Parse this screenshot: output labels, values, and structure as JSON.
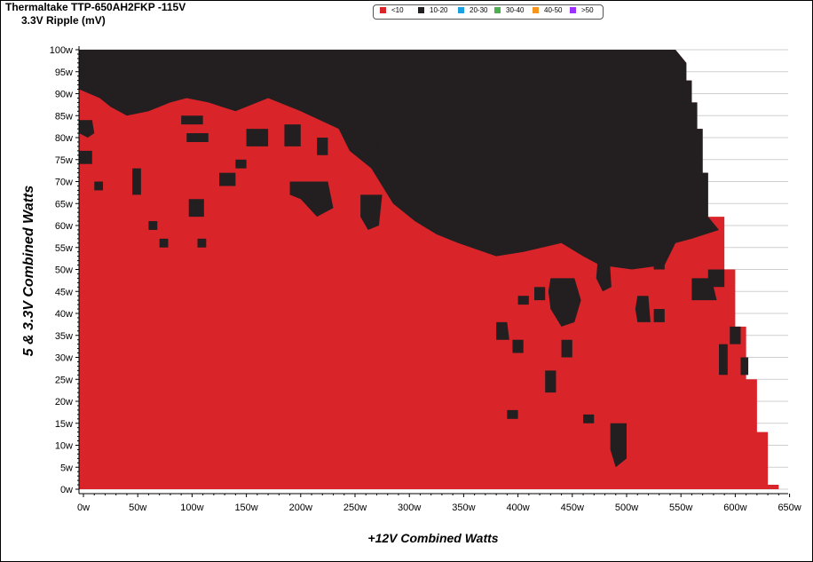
{
  "title": "Thermaltake TTP-650AH2FKP -115V",
  "subtitle": "3.3V Ripple (mV)",
  "colors": {
    "lt10": "#d9242a",
    "10-20": "#231f20",
    "20-30": "#1ba1e2",
    "30-40": "#4caf50",
    "40-50": "#f7941d",
    "gt50": "#9b30ff"
  },
  "chart_data": {
    "type": "heatmap",
    "xlabel": "+12V Combined Watts",
    "ylabel": "5 & 3.3V Combined Watts",
    "xlim": [
      0,
      650
    ],
    "ylim": [
      0,
      100
    ],
    "grid": true,
    "legend_placement": "top-center",
    "x_ticks": [
      "0w",
      "50w",
      "100w",
      "150w",
      "200w",
      "250w",
      "300w",
      "350w",
      "400w",
      "450w",
      "500w",
      "550w",
      "600w",
      "650w"
    ],
    "y_ticks": [
      "0w",
      "5w",
      "10w",
      "15w",
      "20w",
      "25w",
      "30w",
      "35w",
      "40w",
      "45w",
      "50w",
      "55w",
      "60w",
      "65w",
      "70w",
      "75w",
      "80w",
      "85w",
      "90w",
      "95w",
      "100w"
    ],
    "legend": [
      {
        "label": "<10",
        "color": "#d9242a"
      },
      {
        "label": "10-20",
        "color": "#231f20"
      },
      {
        "label": "20-30",
        "color": "#1ba1e2"
      },
      {
        "label": "30-40",
        "color": "#4caf50"
      },
      {
        "label": "40-50",
        "color": "#f7941d"
      },
      {
        "label": ">50",
        "color": "#9b30ff"
      }
    ],
    "load_limit": [
      [
        0,
        100
      ],
      [
        545,
        100
      ],
      [
        555,
        97
      ],
      [
        555,
        93
      ],
      [
        560,
        93
      ],
      [
        560,
        88
      ],
      [
        565,
        88
      ],
      [
        565,
        82
      ],
      [
        570,
        82
      ],
      [
        570,
        72
      ],
      [
        575,
        72
      ],
      [
        575,
        62
      ],
      [
        590,
        62
      ],
      [
        590,
        50
      ],
      [
        600,
        50
      ],
      [
        600,
        37
      ],
      [
        610,
        37
      ],
      [
        610,
        25
      ],
      [
        620,
        25
      ],
      [
        620,
        13
      ],
      [
        630,
        13
      ],
      [
        630,
        1
      ],
      [
        640,
        1
      ],
      [
        640,
        0
      ]
    ],
    "high_ripple_regions": [
      {
        "range": "10-20",
        "polygon": [
          [
            0,
            100
          ],
          [
            545,
            100
          ],
          [
            555,
            97
          ],
          [
            555,
            93
          ],
          [
            560,
            93
          ],
          [
            560,
            88
          ],
          [
            565,
            88
          ],
          [
            565,
            82
          ],
          [
            570,
            82
          ],
          [
            570,
            72
          ],
          [
            575,
            72
          ],
          [
            575,
            62
          ],
          [
            585,
            59
          ],
          [
            560,
            57
          ],
          [
            545,
            56
          ],
          [
            535,
            51
          ],
          [
            505,
            50
          ],
          [
            475,
            51
          ],
          [
            460,
            53
          ],
          [
            440,
            56
          ],
          [
            405,
            54
          ],
          [
            380,
            53
          ],
          [
            345,
            56
          ],
          [
            325,
            58
          ],
          [
            305,
            61
          ],
          [
            285,
            65
          ],
          [
            275,
            69
          ],
          [
            265,
            73
          ],
          [
            245,
            77
          ],
          [
            235,
            82
          ],
          [
            200,
            86
          ],
          [
            170,
            89
          ],
          [
            140,
            86
          ],
          [
            115,
            88
          ],
          [
            95,
            89
          ],
          [
            80,
            88
          ],
          [
            60,
            86
          ],
          [
            40,
            85
          ],
          [
            25,
            87
          ],
          [
            15,
            89
          ],
          [
            0,
            91
          ]
        ]
      },
      {
        "range": "10-20",
        "polygon": [
          [
            0,
            84
          ],
          [
            8,
            84
          ],
          [
            10,
            81
          ],
          [
            4,
            80
          ],
          [
            0,
            81
          ]
        ]
      },
      {
        "range": "10-20",
        "polygon": [
          [
            0,
            77
          ],
          [
            8,
            77
          ],
          [
            8,
            74
          ],
          [
            0,
            74
          ]
        ]
      },
      {
        "range": "10-20",
        "polygon": [
          [
            45,
            73
          ],
          [
            53,
            73
          ],
          [
            53,
            67
          ],
          [
            45,
            67
          ]
        ]
      },
      {
        "range": "10-20",
        "polygon": [
          [
            97,
            66
          ],
          [
            111,
            66
          ],
          [
            111,
            62
          ],
          [
            97,
            62
          ]
        ]
      },
      {
        "range": "10-20",
        "polygon": [
          [
            125,
            72
          ],
          [
            140,
            72
          ],
          [
            140,
            69
          ],
          [
            125,
            69
          ]
        ]
      },
      {
        "range": "10-20",
        "polygon": [
          [
            190,
            70
          ],
          [
            225,
            70
          ],
          [
            230,
            64
          ],
          [
            215,
            62
          ],
          [
            200,
            66
          ],
          [
            190,
            67
          ]
        ]
      },
      {
        "range": "10-20",
        "polygon": [
          [
            255,
            67
          ],
          [
            275,
            67
          ],
          [
            272,
            60
          ],
          [
            262,
            59
          ],
          [
            255,
            62
          ]
        ]
      },
      {
        "range": "10-20",
        "polygon": [
          [
            90,
            85
          ],
          [
            110,
            85
          ],
          [
            110,
            83
          ],
          [
            90,
            83
          ]
        ]
      },
      {
        "range": "10-20",
        "polygon": [
          [
            95,
            81
          ],
          [
            115,
            81
          ],
          [
            115,
            79
          ],
          [
            95,
            79
          ]
        ]
      },
      {
        "range": "10-20",
        "polygon": [
          [
            150,
            82
          ],
          [
            170,
            82
          ],
          [
            170,
            78
          ],
          [
            150,
            78
          ]
        ]
      },
      {
        "range": "10-20",
        "polygon": [
          [
            185,
            83
          ],
          [
            200,
            83
          ],
          [
            200,
            78
          ],
          [
            185,
            78
          ]
        ]
      },
      {
        "range": "10-20",
        "polygon": [
          [
            215,
            80
          ],
          [
            225,
            80
          ],
          [
            225,
            76
          ],
          [
            215,
            76
          ]
        ]
      },
      {
        "range": "10-20",
        "polygon": [
          [
            140,
            75
          ],
          [
            150,
            75
          ],
          [
            150,
            73
          ],
          [
            140,
            73
          ]
        ]
      },
      {
        "range": "10-20",
        "polygon": [
          [
            260,
            80
          ],
          [
            270,
            80
          ],
          [
            270,
            77
          ],
          [
            260,
            77
          ]
        ]
      },
      {
        "range": "10-20",
        "polygon": [
          [
            10,
            70
          ],
          [
            18,
            70
          ],
          [
            18,
            68
          ],
          [
            10,
            68
          ]
        ]
      },
      {
        "range": "10-20",
        "polygon": [
          [
            60,
            61
          ],
          [
            68,
            61
          ],
          [
            68,
            59
          ],
          [
            60,
            59
          ]
        ]
      },
      {
        "range": "10-20",
        "polygon": [
          [
            70,
            57
          ],
          [
            78,
            57
          ],
          [
            78,
            55
          ],
          [
            70,
            55
          ]
        ]
      },
      {
        "range": "10-20",
        "polygon": [
          [
            105,
            57
          ],
          [
            113,
            57
          ],
          [
            113,
            55
          ],
          [
            105,
            55
          ]
        ]
      },
      {
        "range": "10-20",
        "polygon": [
          [
            430,
            48
          ],
          [
            452,
            48
          ],
          [
            458,
            43
          ],
          [
            452,
            38
          ],
          [
            440,
            37
          ],
          [
            430,
            41
          ],
          [
            428,
            45
          ]
        ]
      },
      {
        "range": "10-20",
        "polygon": [
          [
            474,
            54
          ],
          [
            484,
            54
          ],
          [
            486,
            46
          ],
          [
            478,
            45
          ],
          [
            472,
            48
          ]
        ]
      },
      {
        "range": "10-20",
        "polygon": [
          [
            415,
            46
          ],
          [
            425,
            46
          ],
          [
            425,
            43
          ],
          [
            415,
            43
          ]
        ]
      },
      {
        "range": "10-20",
        "polygon": [
          [
            400,
            44
          ],
          [
            410,
            44
          ],
          [
            410,
            42
          ],
          [
            400,
            42
          ]
        ]
      },
      {
        "range": "10-20",
        "polygon": [
          [
            510,
            44
          ],
          [
            520,
            44
          ],
          [
            522,
            38
          ],
          [
            510,
            38
          ],
          [
            508,
            41
          ]
        ]
      },
      {
        "range": "10-20",
        "polygon": [
          [
            525,
            52
          ],
          [
            535,
            52
          ],
          [
            535,
            50
          ],
          [
            525,
            50
          ]
        ]
      },
      {
        "range": "10-20",
        "polygon": [
          [
            560,
            48
          ],
          [
            578,
            48
          ],
          [
            583,
            43
          ],
          [
            560,
            43
          ]
        ]
      },
      {
        "range": "10-20",
        "polygon": [
          [
            575,
            50
          ],
          [
            590,
            50
          ],
          [
            590,
            46
          ],
          [
            575,
            46
          ]
        ]
      },
      {
        "range": "10-20",
        "polygon": [
          [
            380,
            38
          ],
          [
            390,
            38
          ],
          [
            392,
            34
          ],
          [
            380,
            34
          ]
        ]
      },
      {
        "range": "10-20",
        "polygon": [
          [
            395,
            34
          ],
          [
            405,
            34
          ],
          [
            405,
            31
          ],
          [
            395,
            31
          ]
        ]
      },
      {
        "range": "10-20",
        "polygon": [
          [
            440,
            34
          ],
          [
            450,
            34
          ],
          [
            450,
            30
          ],
          [
            440,
            30
          ]
        ]
      },
      {
        "range": "10-20",
        "polygon": [
          [
            425,
            27
          ],
          [
            435,
            27
          ],
          [
            435,
            22
          ],
          [
            425,
            22
          ]
        ]
      },
      {
        "range": "10-20",
        "polygon": [
          [
            485,
            15
          ],
          [
            500,
            15
          ],
          [
            500,
            7
          ],
          [
            490,
            5
          ],
          [
            485,
            9
          ]
        ]
      },
      {
        "range": "10-20",
        "polygon": [
          [
            390,
            18
          ],
          [
            400,
            18
          ],
          [
            400,
            16
          ],
          [
            390,
            16
          ]
        ]
      },
      {
        "range": "10-20",
        "polygon": [
          [
            460,
            17
          ],
          [
            470,
            17
          ],
          [
            470,
            15
          ],
          [
            460,
            15
          ]
        ]
      },
      {
        "range": "10-20",
        "polygon": [
          [
            595,
            37
          ],
          [
            605,
            37
          ],
          [
            605,
            33
          ],
          [
            595,
            33
          ]
        ]
      },
      {
        "range": "10-20",
        "polygon": [
          [
            585,
            33
          ],
          [
            593,
            33
          ],
          [
            593,
            26
          ],
          [
            585,
            26
          ]
        ]
      },
      {
        "range": "10-20",
        "polygon": [
          [
            605,
            30
          ],
          [
            612,
            30
          ],
          [
            612,
            26
          ],
          [
            605,
            26
          ]
        ]
      },
      {
        "range": "10-20",
        "polygon": [
          [
            525,
            41
          ],
          [
            535,
            41
          ],
          [
            535,
            38
          ],
          [
            525,
            38
          ]
        ]
      }
    ]
  }
}
